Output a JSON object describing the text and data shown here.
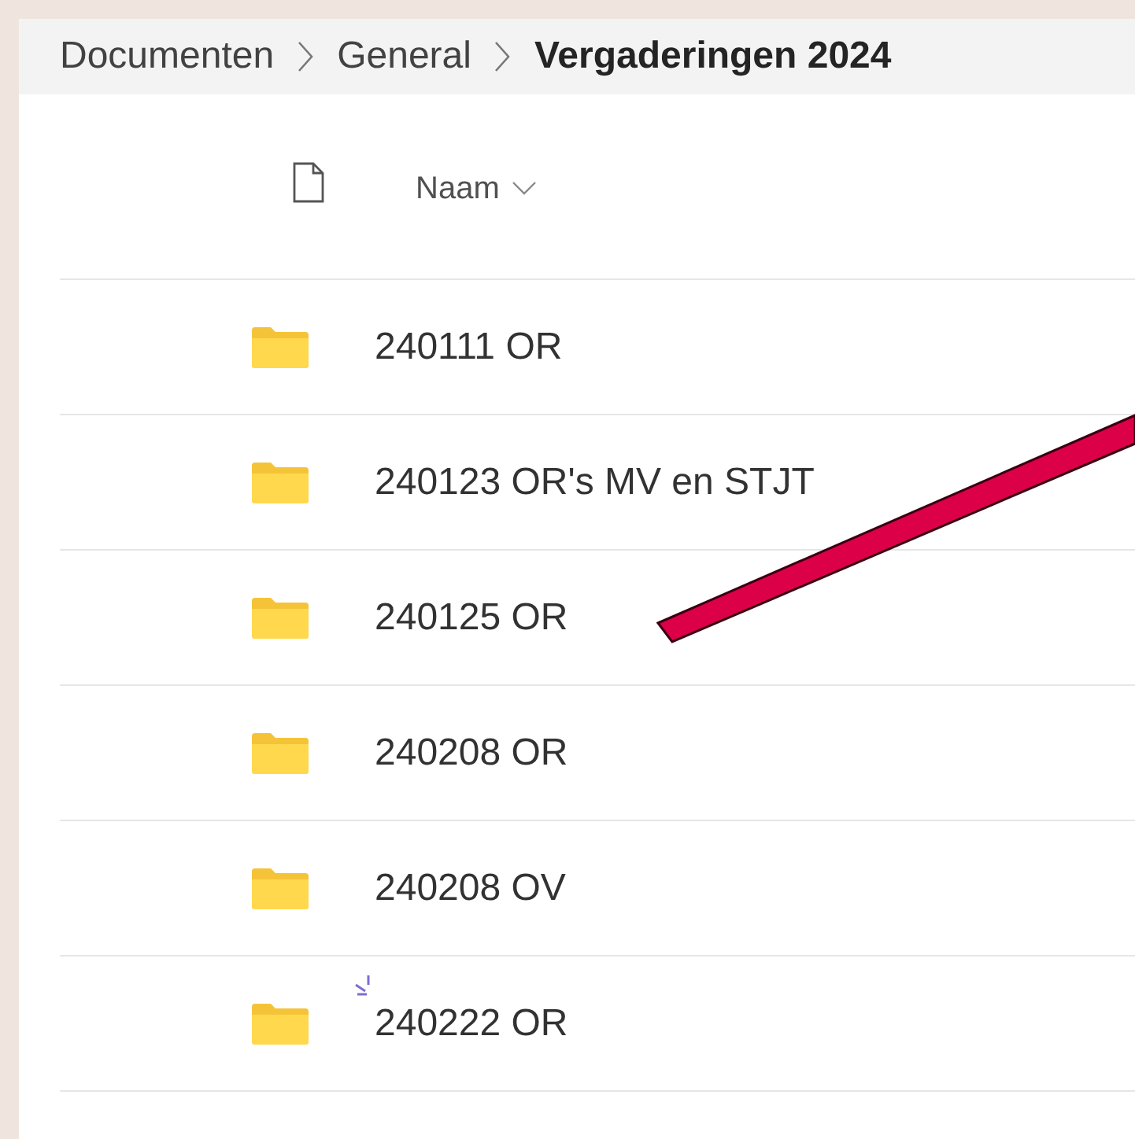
{
  "breadcrumb": [
    {
      "label": "Documenten",
      "current": false
    },
    {
      "label": "General",
      "current": false
    },
    {
      "label": "Vergaderingen 2024",
      "current": true
    }
  ],
  "table": {
    "columns": [
      {
        "label": "Naam",
        "sorted": true
      }
    ],
    "rows": [
      {
        "name": "240111 OR",
        "loading": false
      },
      {
        "name": "240123 OR's MV en STJT",
        "loading": false
      },
      {
        "name": "240125 OR",
        "loading": false
      },
      {
        "name": "240208 OR",
        "loading": false
      },
      {
        "name": "240208 OV",
        "loading": false
      },
      {
        "name": "240222 OR",
        "loading": true
      }
    ]
  }
}
